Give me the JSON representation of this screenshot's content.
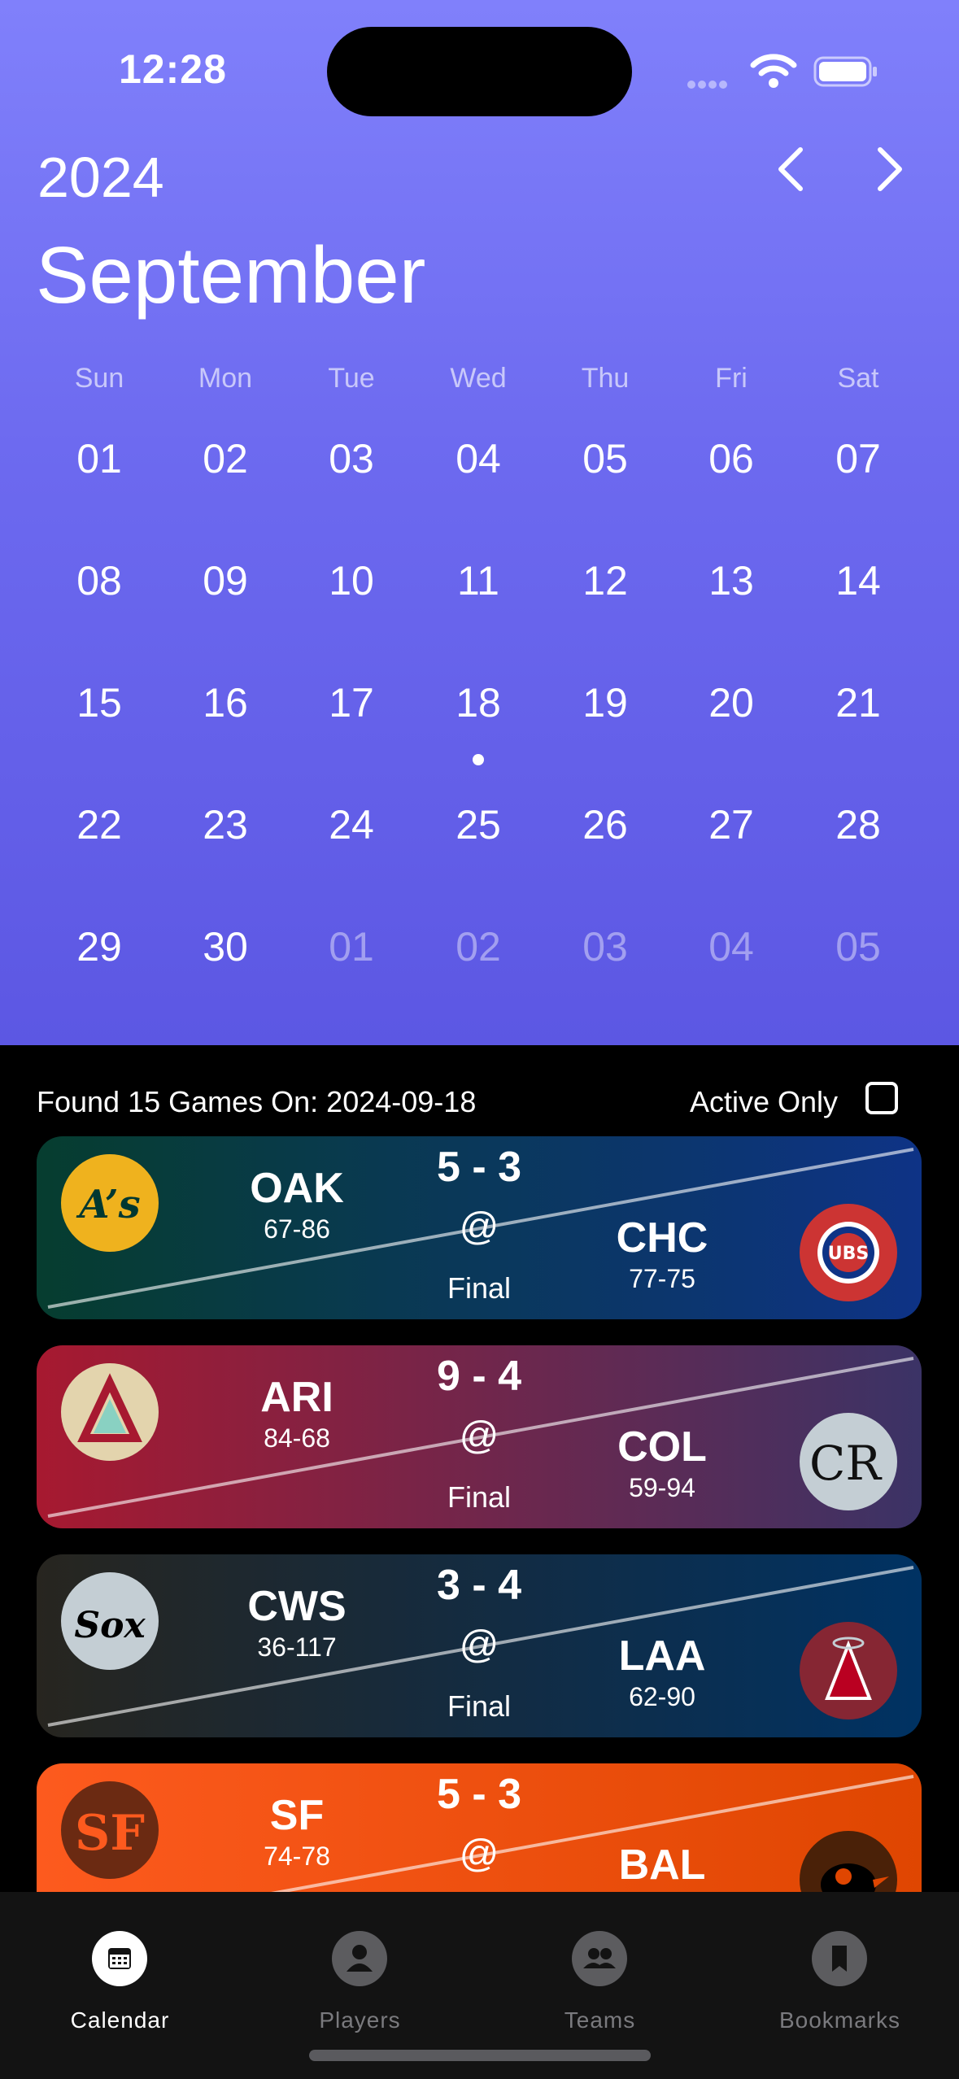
{
  "status_bar": {
    "time": "12:28"
  },
  "calendar": {
    "year": "2024",
    "month": "September",
    "weekdays": [
      "Sun",
      "Mon",
      "Tue",
      "Wed",
      "Thu",
      "Fri",
      "Sat"
    ],
    "weeks": [
      [
        "01",
        "02",
        "03",
        "04",
        "05",
        "06",
        "07"
      ],
      [
        "08",
        "09",
        "10",
        "11",
        "12",
        "13",
        "14"
      ],
      [
        "15",
        "16",
        "17",
        "18",
        "19",
        "20",
        "21"
      ],
      [
        "22",
        "23",
        "24",
        "25",
        "26",
        "27",
        "28"
      ],
      [
        "29",
        "30",
        "01",
        "02",
        "03",
        "04",
        "05"
      ]
    ],
    "selected_day": "18"
  },
  "filter": {
    "found_text": "Found 15 Games On: 2024-09-18",
    "active_only_label": "Active Only",
    "active_only_checked": false
  },
  "games": [
    {
      "away": "OAK",
      "away_record": "67-86",
      "home": "CHC",
      "home_record": "77-75",
      "score": "5 - 3",
      "at": "@",
      "status": "Final",
      "colors": [
        "#063d2f",
        "#0e3386"
      ],
      "away_logo": "athletics-logo",
      "home_logo": "cubs-logo"
    },
    {
      "away": "ARI",
      "away_record": "84-68",
      "home": "COL",
      "home_record": "59-94",
      "score": "9 - 4",
      "at": "@",
      "status": "Final",
      "colors": [
        "#a71930",
        "#3b3366"
      ],
      "away_logo": "diamondbacks-logo",
      "home_logo": "rockies-logo"
    },
    {
      "away": "CWS",
      "away_record": "36-117",
      "home": "LAA",
      "home_record": "62-90",
      "score": "3 - 4",
      "at": "@",
      "status": "Final",
      "colors": [
        "#27251f",
        "#003263"
      ],
      "away_logo": "white-sox-logo",
      "home_logo": "angels-logo"
    },
    {
      "away": "SF",
      "away_record": "74-78",
      "home": "BAL",
      "home_record": "",
      "score": "5 - 3",
      "at": "@",
      "status": "",
      "colors": [
        "#fd5a1e",
        "#df4601"
      ],
      "away_logo": "giants-logo",
      "home_logo": "orioles-logo"
    }
  ],
  "tabs": [
    {
      "label": "Calendar",
      "icon": "calendar-icon",
      "active": true
    },
    {
      "label": "Players",
      "icon": "person-icon",
      "active": false
    },
    {
      "label": "Teams",
      "icon": "people-icon",
      "active": false
    },
    {
      "label": "Bookmarks",
      "icon": "bookmark-icon",
      "active": false
    }
  ]
}
